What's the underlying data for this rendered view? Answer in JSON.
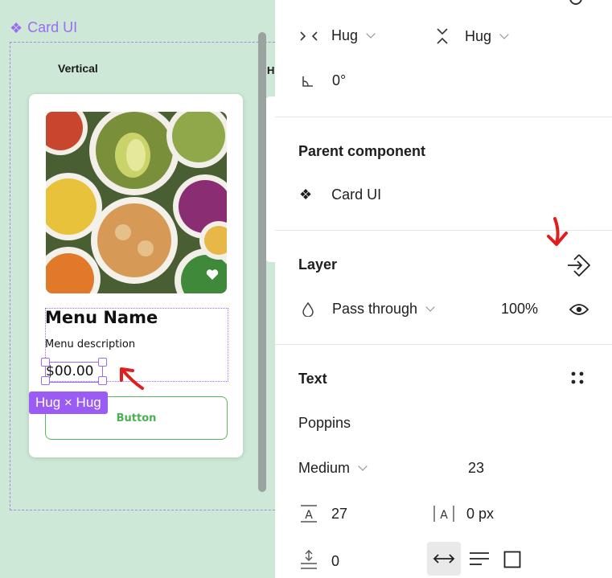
{
  "canvas": {
    "component_title": "Card UI",
    "variant_label": "Vertical",
    "variant_label_2": "H",
    "card": {
      "menu_name": "Menu Name",
      "menu_description": "Menu description",
      "price": "$00.00",
      "button_label": "Button",
      "size_badge": "Hug × Hug"
    }
  },
  "panel": {
    "layout": {
      "width_mode": "Hug",
      "height_mode": "Hug",
      "rotation": "0°"
    },
    "parent_component": {
      "title": "Parent component",
      "name": "Card UI"
    },
    "layer": {
      "title": "Layer",
      "blend_mode": "Pass through",
      "opacity": "100%"
    },
    "text": {
      "title": "Text",
      "font_family": "Poppins",
      "font_weight": "Medium",
      "font_size": "23",
      "line_height": "27",
      "letter_spacing": "0 px",
      "paragraph_spacing": "0"
    }
  },
  "colors": {
    "canvas_bg": "#cde8d6",
    "selection": "#9b6cf2",
    "button_green": "#4caf50",
    "annotation_red": "#e11d1d"
  }
}
